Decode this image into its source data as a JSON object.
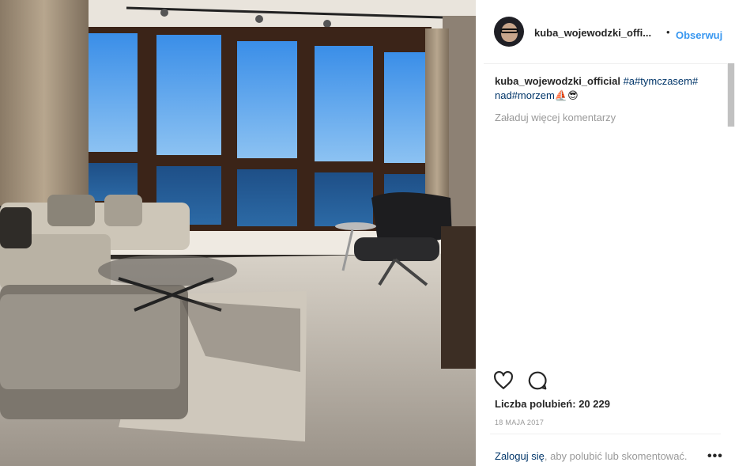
{
  "post": {
    "image": {
      "description_icon": "photo"
    },
    "header": {
      "username": "kuba_wojewodzki_offi...",
      "separator": "•",
      "follow_label": "Obserwuj"
    },
    "caption": {
      "username": "kuba_wojewodzki_official",
      "text_parts": [
        "#a#tymczasem#",
        "nad#morzem",
        "⛵",
        "😎"
      ]
    },
    "load_more_label": "Załaduj więcej komentarzy",
    "actions": {
      "like_icon": "heart-icon",
      "comment_icon": "comment-icon"
    },
    "likes_label": "Liczba polubień:",
    "likes_count": "20 229",
    "date": "18 MAJA 2017",
    "login": {
      "link_label": "Zaloguj się",
      "rest_label": ", aby polubić lub skomentować.",
      "more_label": "•••"
    },
    "colors": {
      "link_blue": "#3897f0",
      "hashtag": "#003569",
      "muted": "#999999",
      "text": "#262626"
    }
  }
}
